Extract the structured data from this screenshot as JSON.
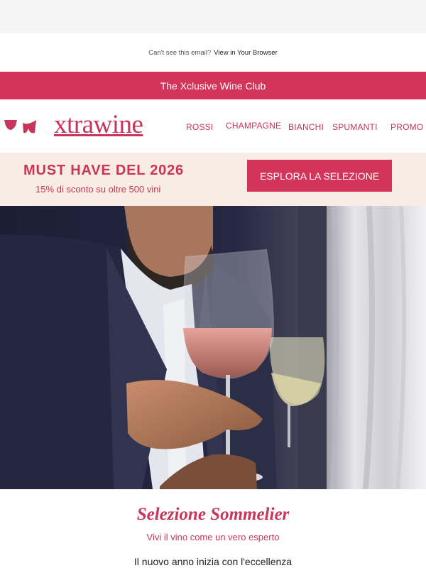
{
  "preheader": {
    "text": "Can't see this email?",
    "link": "View in Your Browser"
  },
  "club_bar": {
    "label": "The Xclusive Wine Club"
  },
  "nav": {
    "brand": "xtrawine",
    "links": [
      "ROSSI",
      "CHAMPAGNE",
      "BIANCHI",
      "SPUMANTI",
      "PROMO"
    ]
  },
  "promo": {
    "title": "MUST HAVE DEL 2026",
    "subtitle": "15% di sconto su oltre 500 vini",
    "button": "ESPLORA LA SELEZIONE"
  },
  "hero": {
    "icon": "hero-photo-man-holding-wine-glasses"
  },
  "section": {
    "title": "Selezione Sommelier",
    "subtitle": "Vivi il vino come un vero esperto",
    "body": "Il nuovo anno inizia con l'eccellenza"
  },
  "colors": {
    "brand": "#d5345a",
    "brand_text": "#c8355a",
    "cream": "#f7ede4",
    "gray": "#f5f5f5"
  }
}
